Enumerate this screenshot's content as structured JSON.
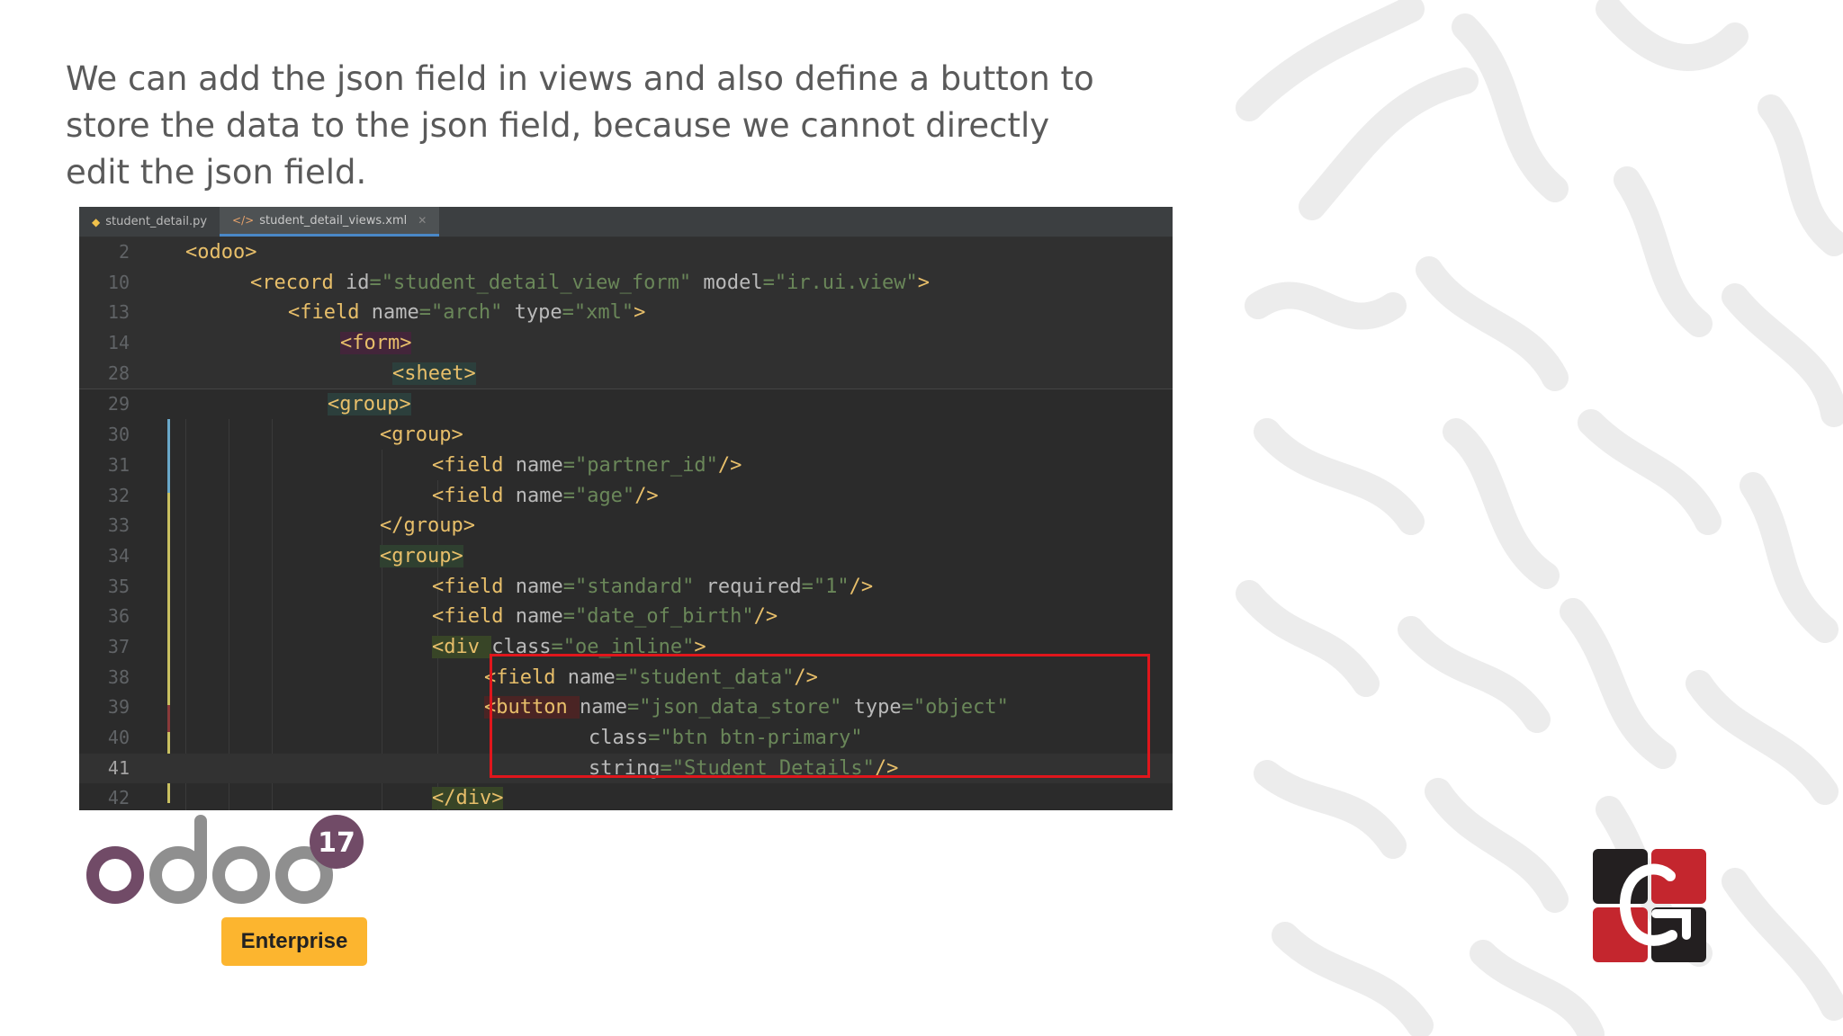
{
  "heading": "We can add the json field in views and also define a button to store the data to the json field, because we cannot directly edit the json field.",
  "editor": {
    "tabs": [
      {
        "label": "student_detail.py",
        "icon": "python-file-icon",
        "active": false
      },
      {
        "label": "student_detail_views.xml",
        "icon": "xml-file-icon",
        "active": true
      }
    ],
    "lines": [
      {
        "n": "2",
        "segs": [
          [
            "tag",
            "<odoo>"
          ]
        ]
      },
      {
        "n": "10",
        "segs": [
          [
            "tag",
            "<record "
          ],
          [
            "attr",
            "id"
          ],
          [
            "val",
            "=\"student_detail_view_form\""
          ],
          [
            "attr",
            " model"
          ],
          [
            "val",
            "=\"ir.ui.view\""
          ],
          [
            "tag",
            ">"
          ]
        ]
      },
      {
        "n": "13",
        "segs": [
          [
            "tag",
            "<field "
          ],
          [
            "attr",
            "name"
          ],
          [
            "val",
            "=\"arch\""
          ],
          [
            "attr",
            " type"
          ],
          [
            "val",
            "=\"xml\""
          ],
          [
            "tag",
            ">"
          ]
        ]
      },
      {
        "n": "14",
        "segs": [
          [
            "tag",
            "<form>"
          ]
        ]
      },
      {
        "n": "28",
        "segs": [
          [
            "tag",
            "<sheet>"
          ]
        ]
      },
      {
        "n": "29",
        "segs": [
          [
            "tag",
            "<group>"
          ]
        ]
      },
      {
        "n": "30",
        "segs": [
          [
            "tag",
            "<group>"
          ]
        ]
      },
      {
        "n": "31",
        "segs": [
          [
            "tag",
            "<field "
          ],
          [
            "attr",
            "name"
          ],
          [
            "val",
            "=\"partner_id\""
          ],
          [
            "tag",
            "/>"
          ]
        ]
      },
      {
        "n": "32",
        "segs": [
          [
            "tag",
            "<field "
          ],
          [
            "attr",
            "name"
          ],
          [
            "val",
            "=\"age\""
          ],
          [
            "tag",
            "/>"
          ]
        ]
      },
      {
        "n": "33",
        "segs": [
          [
            "tag",
            "</group>"
          ]
        ]
      },
      {
        "n": "34",
        "segs": [
          [
            "tag",
            "<group>"
          ]
        ]
      },
      {
        "n": "35",
        "segs": [
          [
            "tag",
            "<field "
          ],
          [
            "attr",
            "name"
          ],
          [
            "val",
            "=\"standard\""
          ],
          [
            "attr",
            " required"
          ],
          [
            "val",
            "=\"1\""
          ],
          [
            "tag",
            "/>"
          ]
        ]
      },
      {
        "n": "36",
        "segs": [
          [
            "tag",
            "<field "
          ],
          [
            "attr",
            "name"
          ],
          [
            "val",
            "=\"date_of_birth\""
          ],
          [
            "tag",
            "/>"
          ]
        ]
      },
      {
        "n": "37",
        "segs": [
          [
            "tag",
            "<div "
          ],
          [
            "attr",
            "class"
          ],
          [
            "val",
            "=\"oe_inline\""
          ],
          [
            "tag",
            ">"
          ]
        ]
      },
      {
        "n": "38",
        "segs": [
          [
            "tag",
            "<field "
          ],
          [
            "attr",
            "name"
          ],
          [
            "val",
            "=\"student_data\""
          ],
          [
            "tag",
            "/>"
          ]
        ]
      },
      {
        "n": "39",
        "segs": [
          [
            "tag",
            "<button "
          ],
          [
            "attr",
            "name"
          ],
          [
            "val",
            "=\"json_data_store\""
          ],
          [
            "attr",
            " type"
          ],
          [
            "val",
            "=\"object\""
          ]
        ]
      },
      {
        "n": "40",
        "segs": [
          [
            "attr",
            "class"
          ],
          [
            "val",
            "=\"btn btn-primary\""
          ]
        ]
      },
      {
        "n": "41",
        "segs": [
          [
            "attr",
            "string"
          ],
          [
            "val",
            "=\"Student Details\""
          ],
          [
            "tag",
            "/>"
          ]
        ]
      },
      {
        "n": "42",
        "segs": [
          [
            "tag",
            "</div>"
          ]
        ]
      }
    ]
  },
  "branding": {
    "product_logo_text": "odoo",
    "version_badge": "17",
    "edition": "Enterprise",
    "colors": {
      "odoo_purple": "#714b67",
      "odoo_grey": "#8f8f8f",
      "edition_yellow": "#fcb52f",
      "company_red": "#c4262e",
      "company_dark": "#231f20"
    }
  }
}
